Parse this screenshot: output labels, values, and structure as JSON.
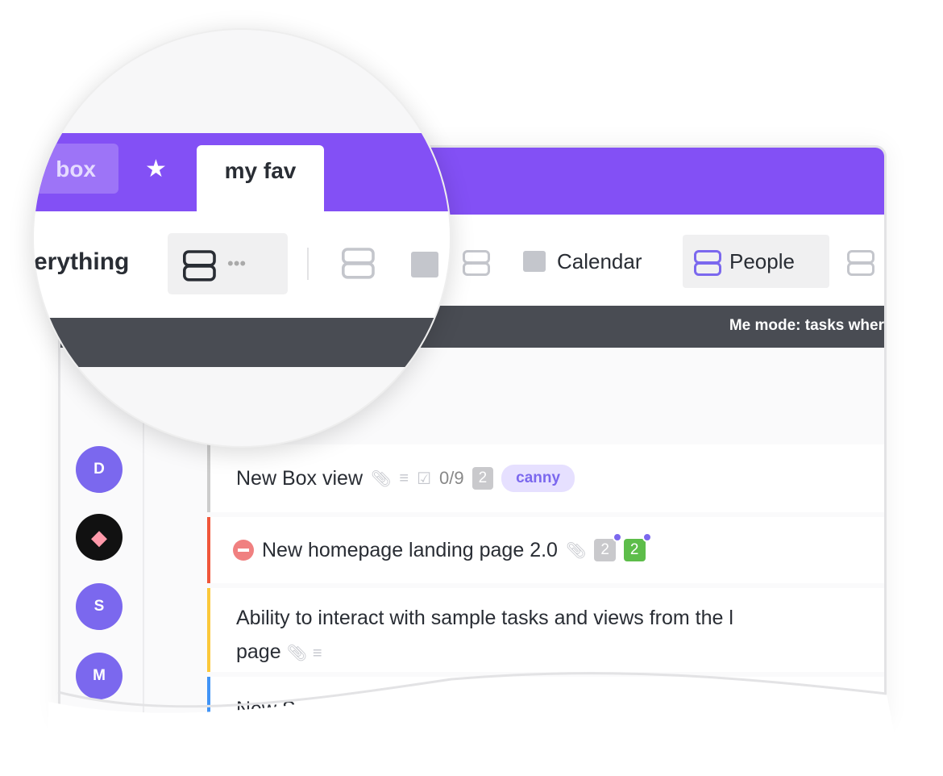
{
  "tabs": {
    "inbox": "box",
    "favorites": "my fav"
  },
  "toolbar": {
    "everything": "erything",
    "more": "•••",
    "calendar": "Calendar",
    "people": "People"
  },
  "banner": "Me mode: tasks wher",
  "avatars": [
    "D",
    "",
    "S",
    "M"
  ],
  "tasks": [
    {
      "title": "New Box view",
      "checklist": "0/9",
      "count": "2",
      "tag": "canny",
      "color": "#cccccc"
    },
    {
      "title": "New homepage landing page 2.0",
      "count": "2",
      "count2": "2",
      "color": "#f0563a"
    },
    {
      "title": "Ability to interact with sample tasks and views from the l",
      "title2": "page",
      "color": "#fbc83a"
    },
    {
      "title": "New S",
      "color": "#4194f6"
    }
  ],
  "colors": {
    "brand": "#8350f5",
    "accent": "#7b68ee",
    "dark": "#494c53"
  }
}
